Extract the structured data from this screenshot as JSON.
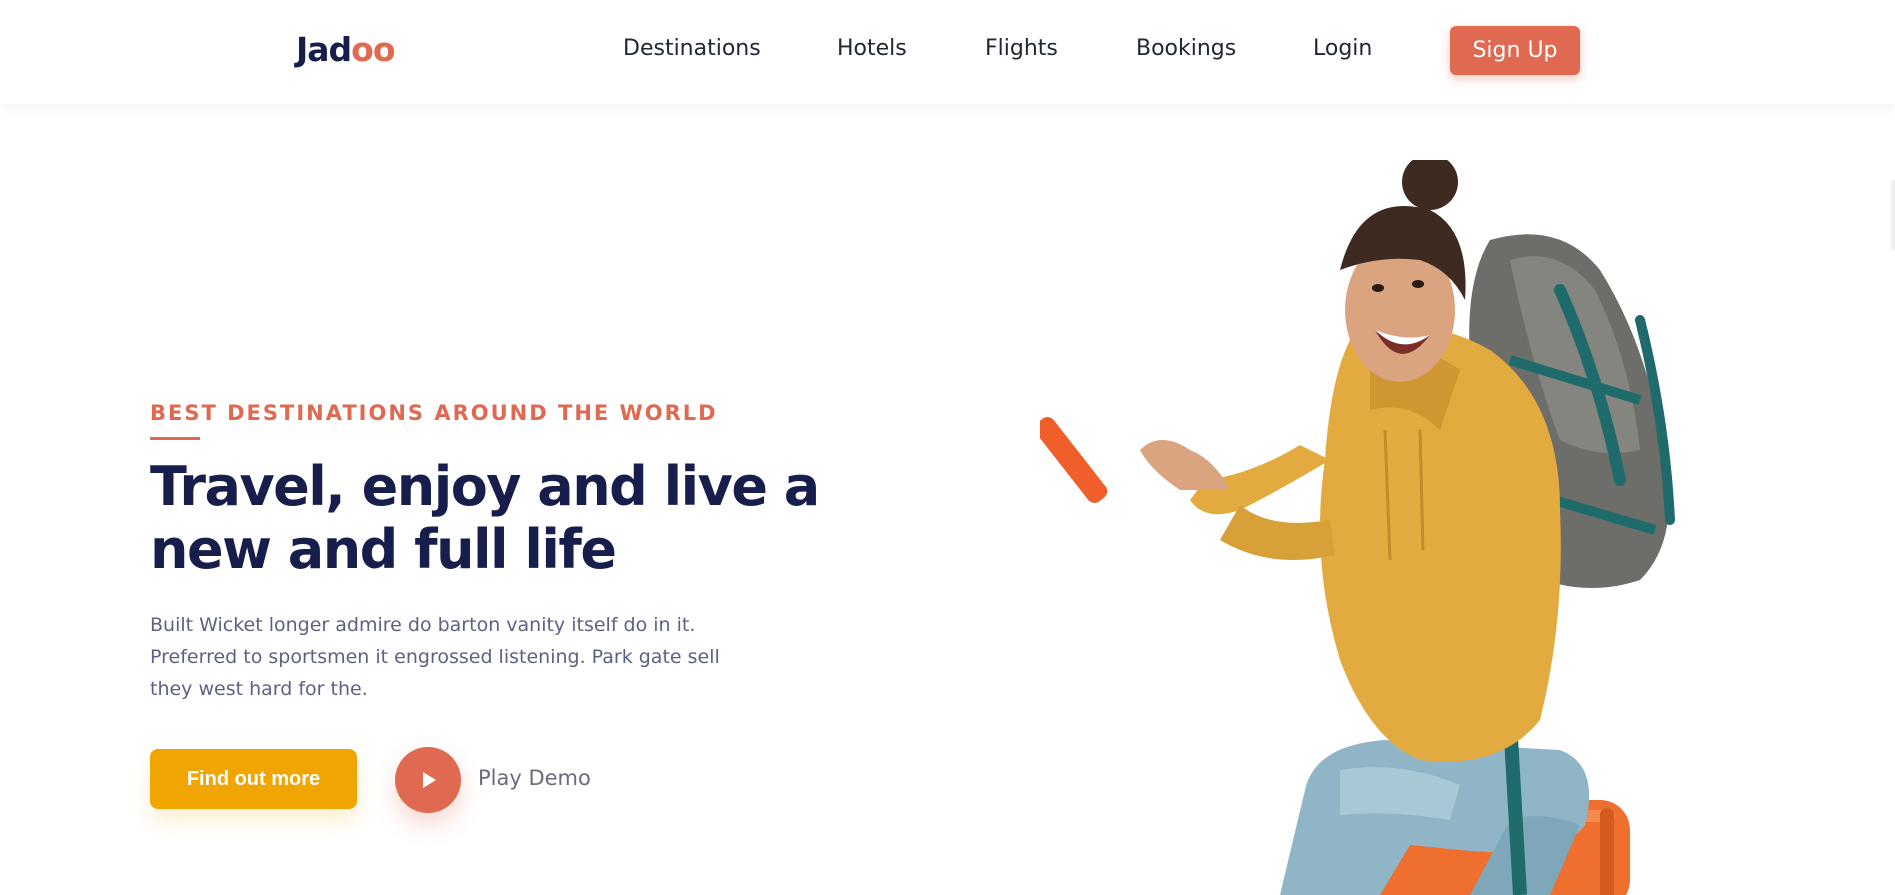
{
  "brand": {
    "logo_main": "Jad",
    "logo_accent": "oo",
    "accent_color": "#df6951",
    "dark_color": "#181e4b"
  },
  "nav": {
    "items": [
      {
        "label": "Destinations"
      },
      {
        "label": "Hotels"
      },
      {
        "label": "Flights"
      },
      {
        "label": "Bookings"
      },
      {
        "label": "Login"
      }
    ],
    "signup_label": "Sign Up"
  },
  "hero": {
    "eyebrow": "BEST DESTINATIONS AROUND THE WORLD",
    "title_line1": "Travel, enjoy and live a",
    "title_line2": "new and full life",
    "description_line1": "Built Wicket longer admire do barton vanity itself do in it.",
    "description_line2": "Preferred to sportsmen it engrossed listening. Park gate sell",
    "description_line3": "they west hard for the.",
    "cta_label": "Find out more",
    "cta_color": "#f1a501",
    "play_label": "Play Demo",
    "play_icon": "play-icon",
    "image_subject": "traveler-with-backpack"
  }
}
